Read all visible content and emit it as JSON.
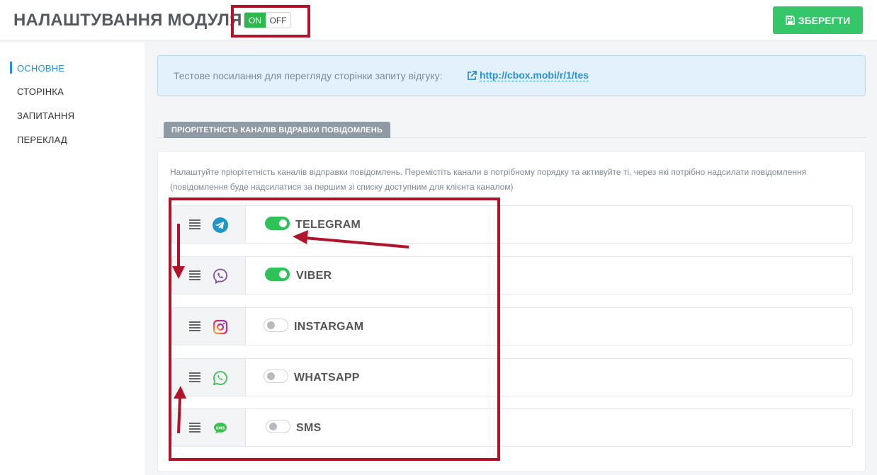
{
  "header": {
    "title": "НАЛАШТУВАННЯ МОДУЛЯ",
    "toggle_on": "ON",
    "toggle_off": "OFF",
    "save_label": "ЗБЕРЕГТИ"
  },
  "sidebar": {
    "items": [
      {
        "label": "ОСНОВНЕ",
        "active": true
      },
      {
        "label": "СТОРІНКА",
        "active": false
      },
      {
        "label": "ЗАПИТАННЯ",
        "active": false
      },
      {
        "label": "ПЕРЕКЛАД",
        "active": false
      }
    ]
  },
  "info": {
    "text": "Тестове посилання для перегляду сторінки запиту відгуку:",
    "link": "http://cbox.mobi/r/1/tes"
  },
  "section": {
    "tab_label": "ПРІОРІТЕТНІСТЬ КАНАЛІВ ВІДРАВКИ ПОВІДОМЛЕНЬ",
    "description": "Налаштуйте пріорітетність каналів відправки повідомлень. Перемістіть канали в потрібному порядку та активуйте ті, через які потрібно надсилати повідомлення (повідомлення буде надсилатися за першим зі списку доступним для клієнта каналом)"
  },
  "channels": [
    {
      "name": "TELEGRAM",
      "enabled": true,
      "icon": "telegram-icon",
      "color": "#1e96c8"
    },
    {
      "name": "VIBER",
      "enabled": true,
      "icon": "viber-icon",
      "color": "#7b519d"
    },
    {
      "name": "INSTARGAM",
      "enabled": false,
      "icon": "instagram-icon",
      "color": "#d6249f"
    },
    {
      "name": "WHATSAPP",
      "enabled": false,
      "icon": "whatsapp-icon",
      "color": "#3bc150"
    },
    {
      "name": "SMS",
      "enabled": false,
      "icon": "sms-icon",
      "color": "#3bc150"
    }
  ],
  "colors": {
    "accent": "#2a8fd6",
    "save_button": "#35c66a",
    "toggle_on": "#2fc15a",
    "annotation": "#b0142b"
  }
}
